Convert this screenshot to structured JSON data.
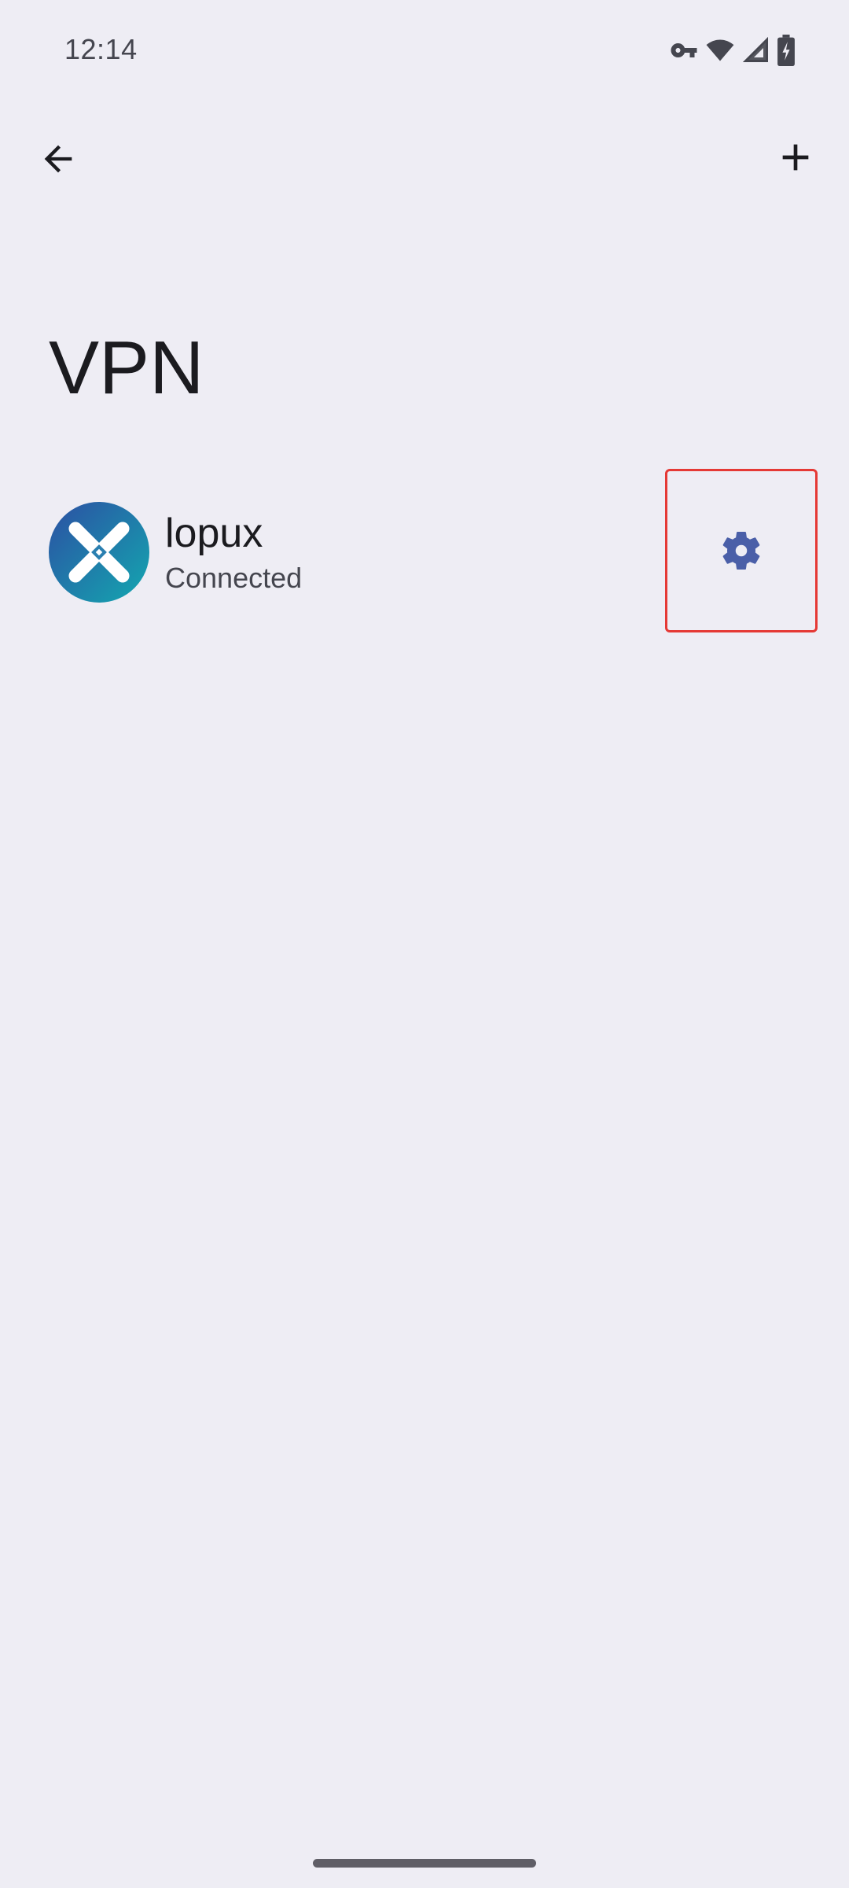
{
  "status_bar": {
    "time": "12:14",
    "icons": [
      "vpn-key-icon",
      "wifi-icon",
      "cell-signal-icon",
      "battery-charging-icon"
    ]
  },
  "top_bar": {
    "back_icon": "arrow-back-icon",
    "add_icon": "plus-icon"
  },
  "page": {
    "title": "VPN"
  },
  "vpn_list": [
    {
      "name": "lopux",
      "status": "Connected",
      "app_icon": "lopux-app-icon",
      "settings_icon": "gear-icon"
    }
  ],
  "colors": {
    "background": "#eeedf4",
    "accent": "#4a5fa8",
    "highlight_border": "#e53935",
    "text_primary": "#1b1b1f",
    "text_secondary": "#45464f"
  }
}
